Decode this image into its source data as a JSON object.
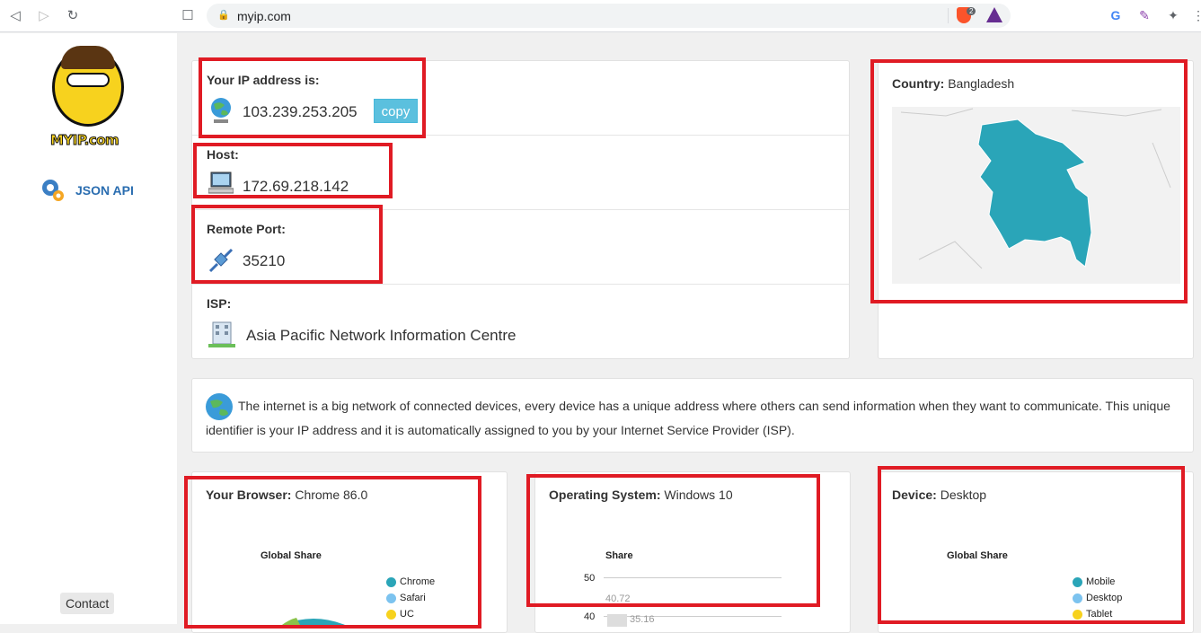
{
  "browser": {
    "url": "myip.com",
    "brave_badge": "2"
  },
  "sidebar": {
    "logo_text": "MYIP.com",
    "api_link": "JSON API",
    "contact": "Contact"
  },
  "ip_card": {
    "ip_label": "Your IP address is:",
    "ip_value": "103.239.253.205",
    "copy_label": "copy",
    "host_label": "Host:",
    "host_value": "172.69.218.142",
    "port_label": "Remote Port:",
    "port_value": "35210",
    "isp_label": "ISP:",
    "isp_value": "Asia Pacific Network Information Centre"
  },
  "country_card": {
    "label": "Country:",
    "value": "Bangladesh",
    "map_color": "#2aa5b8"
  },
  "info_text": "The internet is a big network of connected devices, every device has a unique address where others can send information when they want to communicate. This unique identifier is your IP address and it is automatically assigned to you by your Internet Service Provider (ISP).",
  "browser_card": {
    "label": "Your Browser:",
    "value": "Chrome 86.0",
    "chart_title": "Global Share",
    "legend": [
      {
        "name": "Chrome",
        "color": "#2aa5b8"
      },
      {
        "name": "Safari",
        "color": "#7cc3ef"
      },
      {
        "name": "UC",
        "color": "#f7d21e"
      }
    ]
  },
  "os_card": {
    "label": "Operating System:",
    "value": "Windows 10",
    "chart_title": "Share",
    "ticks": [
      "50",
      "40"
    ],
    "data_labels": [
      "40.72",
      "35.16"
    ]
  },
  "device_card": {
    "label": "Device:",
    "value": "Desktop",
    "chart_title": "Global Share",
    "legend": [
      {
        "name": "Mobile",
        "color": "#2aa5b8"
      },
      {
        "name": "Desktop",
        "color": "#7cc3ef"
      },
      {
        "name": "Tablet",
        "color": "#f7d21e"
      }
    ]
  }
}
